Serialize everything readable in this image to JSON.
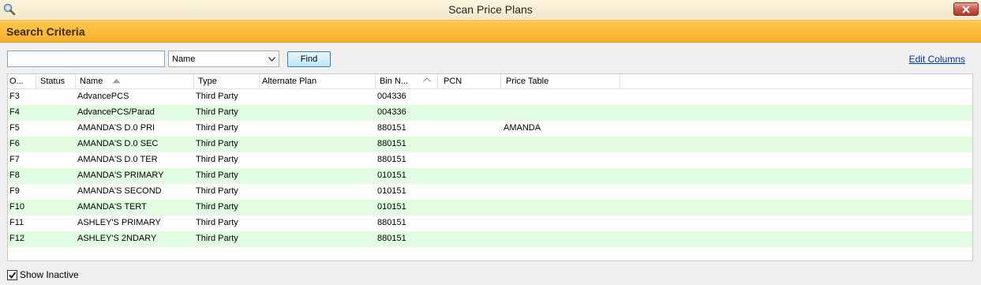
{
  "window": {
    "title": "Scan Price Plans",
    "app_icon": "magnifier-icon",
    "close_icon": "close-icon"
  },
  "criteria": {
    "heading": "Search Criteria"
  },
  "search": {
    "value": "",
    "placeholder": "",
    "field_value": "Name",
    "find_label": "Find",
    "edit_columns_label": "Edit Columns"
  },
  "grid": {
    "columns": [
      "O...",
      "Status",
      "Name",
      "Type",
      "Alternate Plan",
      "Bin N...",
      "PCN",
      "Price Table"
    ],
    "sort_column": "Name",
    "rows": [
      {
        "key": "F3",
        "status": "",
        "name": "AdvancePCS",
        "type": "Third Party",
        "alt": "",
        "bin": "004336",
        "pcn": "",
        "price": ""
      },
      {
        "key": "F4",
        "status": "",
        "name": "AdvancePCS/Parad",
        "type": "Third Party",
        "alt": "",
        "bin": "004336",
        "pcn": "",
        "price": ""
      },
      {
        "key": "F5",
        "status": "",
        "name": "AMANDA'S D.0 PRI",
        "type": "Third Party",
        "alt": "",
        "bin": "880151",
        "pcn": "",
        "price": "AMANDA"
      },
      {
        "key": "F6",
        "status": "",
        "name": "AMANDA'S D.0 SEC",
        "type": "Third Party",
        "alt": "",
        "bin": "880151",
        "pcn": "",
        "price": ""
      },
      {
        "key": "F7",
        "status": "",
        "name": "AMANDA'S D.0 TER",
        "type": "Third Party",
        "alt": "",
        "bin": "880151",
        "pcn": "",
        "price": ""
      },
      {
        "key": "F8",
        "status": "",
        "name": "AMANDA'S PRIMARY",
        "type": "Third Party",
        "alt": "",
        "bin": "010151",
        "pcn": "",
        "price": ""
      },
      {
        "key": "F9",
        "status": "",
        "name": "AMANDA'S SECOND",
        "type": "Third Party",
        "alt": "",
        "bin": "010151",
        "pcn": "",
        "price": ""
      },
      {
        "key": "F10",
        "status": "",
        "name": "AMANDA'S TERT",
        "type": "Third Party",
        "alt": "",
        "bin": "010151",
        "pcn": "",
        "price": ""
      },
      {
        "key": "F11",
        "status": "",
        "name": "ASHLEY'S PRIMARY",
        "type": "Third Party",
        "alt": "",
        "bin": "880151",
        "pcn": "",
        "price": ""
      },
      {
        "key": "F12",
        "status": "",
        "name": "ASHLEY'S 2NDARY",
        "type": "Third Party",
        "alt": "",
        "bin": "880151",
        "pcn": "",
        "price": ""
      }
    ]
  },
  "footer": {
    "show_inactive_label": "Show Inactive",
    "show_inactive_checked": true
  },
  "colors": {
    "header_orange": "#f7b02d",
    "row_alt": "#e1fce1",
    "link": "#0033aa"
  }
}
